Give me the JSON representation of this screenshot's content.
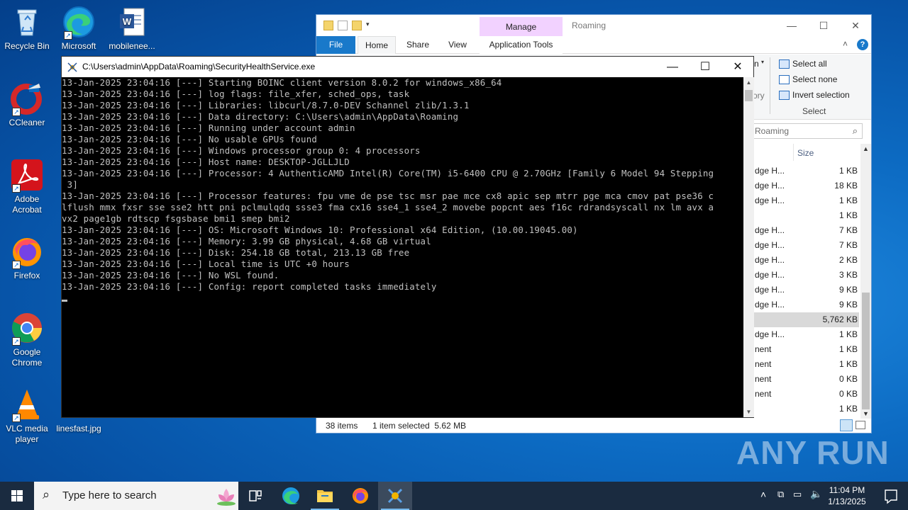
{
  "desktop": {
    "icons": [
      {
        "label": "Recycle Bin"
      },
      {
        "label": "Microsoft Edge"
      },
      {
        "label": "mobilenee..."
      },
      {
        "label": "CCleaner"
      },
      {
        "label": "Adobe Acrobat"
      },
      {
        "label": "Firefox"
      },
      {
        "label": "Google Chrome"
      },
      {
        "label": "VLC media player"
      },
      {
        "label": "linesfast.jpg"
      }
    ]
  },
  "explorer": {
    "manage_tab": "Manage",
    "title": "Roaming",
    "tabs": [
      "File",
      "Home",
      "Share",
      "View",
      "Application Tools"
    ],
    "ribbon": {
      "select_all": "Select all",
      "select_none": "Select none",
      "invert_selection": "Invert selection",
      "group_label": "Select",
      "partial_n": "n",
      "partial_ory": "ory"
    },
    "search_placeholder": "Roaming",
    "column_size": "Size",
    "rows": [
      {
        "name": "dge H...",
        "size": "1 KB"
      },
      {
        "name": "dge H...",
        "size": "18 KB"
      },
      {
        "name": "dge H...",
        "size": "1 KB"
      },
      {
        "name": "",
        "size": "1 KB"
      },
      {
        "name": "dge H...",
        "size": "7 KB"
      },
      {
        "name": "dge H...",
        "size": "7 KB"
      },
      {
        "name": "dge H...",
        "size": "2 KB"
      },
      {
        "name": "dge H...",
        "size": "3 KB"
      },
      {
        "name": "dge H...",
        "size": "9 KB"
      },
      {
        "name": "dge H...",
        "size": "9 KB"
      },
      {
        "name": "",
        "size": "5,762 KB"
      },
      {
        "name": "dge H...",
        "size": "1 KB"
      },
      {
        "name": "nent",
        "size": "1 KB"
      },
      {
        "name": "nent",
        "size": "1 KB"
      },
      {
        "name": "nent",
        "size": "0 KB"
      },
      {
        "name": "nent",
        "size": "0 KB"
      },
      {
        "name": "",
        "size": "1 KB"
      }
    ],
    "status_items": "38 items",
    "status_selected": "1 item selected  5.62 MB"
  },
  "console": {
    "title": "C:\\Users\\admin\\AppData\\Roaming\\SecurityHealthService.exe",
    "lines": [
      "13-Jan-2025 23:04:16 [---] Starting BOINC client version 8.0.2 for windows_x86_64",
      "13-Jan-2025 23:04:16 [---] log flags: file_xfer, sched_ops, task",
      "13-Jan-2025 23:04:16 [---] Libraries: libcurl/8.7.0-DEV Schannel zlib/1.3.1",
      "13-Jan-2025 23:04:16 [---] Data directory: C:\\Users\\admin\\AppData\\Roaming",
      "13-Jan-2025 23:04:16 [---] Running under account admin",
      "13-Jan-2025 23:04:16 [---] No usable GPUs found",
      "13-Jan-2025 23:04:16 [---] Windows processor group 0: 4 processors",
      "13-Jan-2025 23:04:16 [---] Host name: DESKTOP-JGLLJLD",
      "13-Jan-2025 23:04:16 [---] Processor: 4 AuthenticAMD Intel(R) Core(TM) i5-6400 CPU @ 2.70GHz [Family 6 Model 94 Stepping",
      " 3]",
      "13-Jan-2025 23:04:16 [---] Processor features: fpu vme de pse tsc msr pae mce cx8 apic sep mtrr pge mca cmov pat pse36 c",
      "lflush mmx fxsr sse sse2 htt pni pclmulqdq ssse3 fma cx16 sse4_1 sse4_2 movebe popcnt aes f16c rdrandsyscall nx lm avx a",
      "vx2 page1gb rdtscp fsgsbase bmi1 smep bmi2",
      "13-Jan-2025 23:04:16 [---] OS: Microsoft Windows 10: Professional x64 Edition, (10.00.19045.00)",
      "13-Jan-2025 23:04:16 [---] Memory: 3.99 GB physical, 4.68 GB virtual",
      "13-Jan-2025 23:04:16 [---] Disk: 254.18 GB total, 213.13 GB free",
      "13-Jan-2025 23:04:16 [---] Local time is UTC +0 hours",
      "13-Jan-2025 23:04:16 [---] No WSL found.",
      "13-Jan-2025 23:04:16 [---] Config: report completed tasks immediately"
    ]
  },
  "watermark": "ANY RUN",
  "taskbar": {
    "search_placeholder": "Type here to search",
    "time": "11:04 PM",
    "date": "1/13/2025"
  }
}
